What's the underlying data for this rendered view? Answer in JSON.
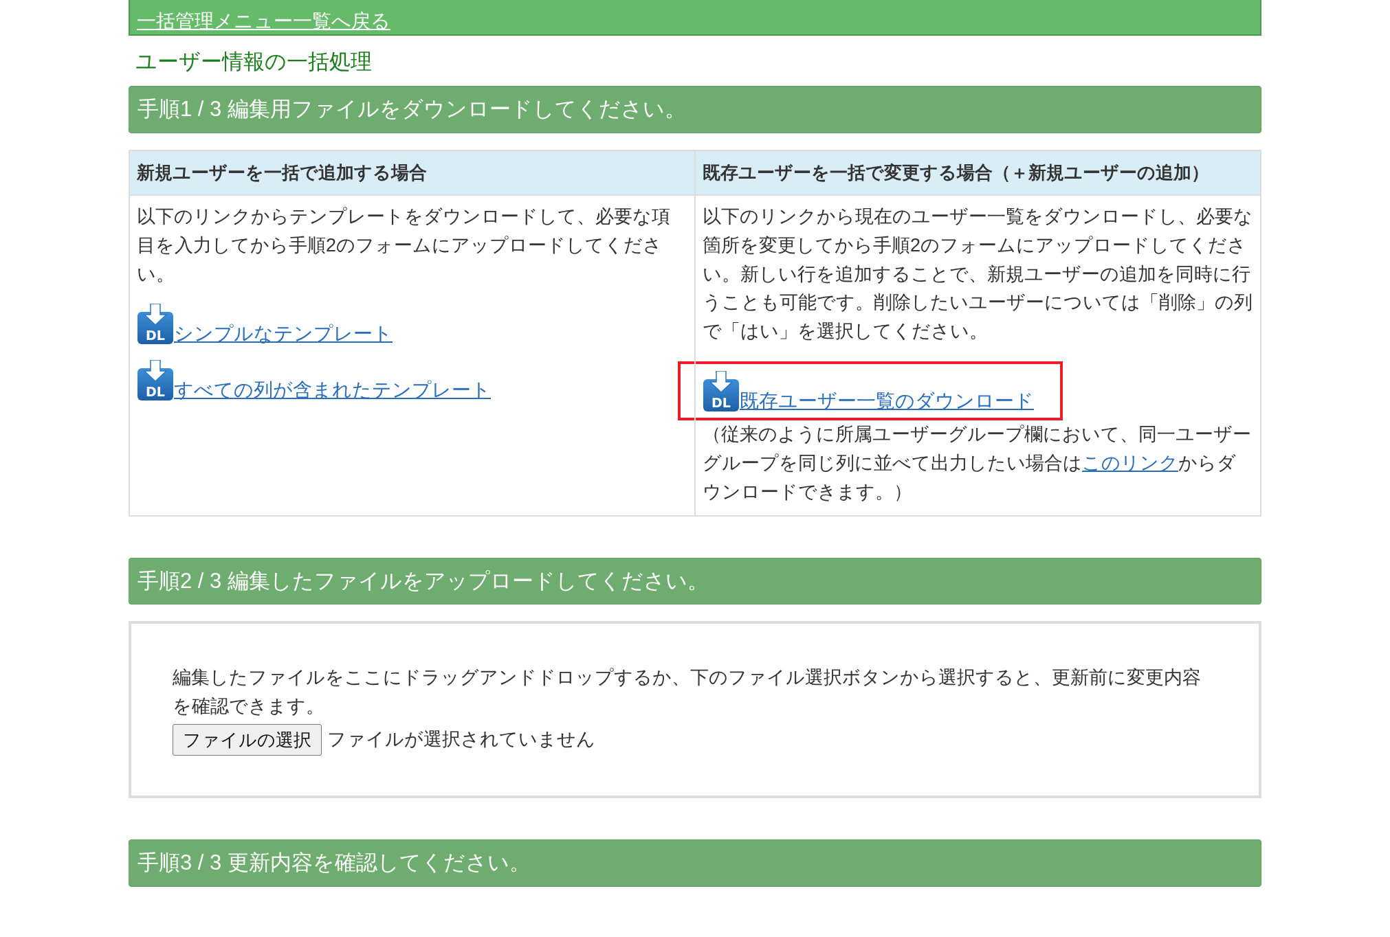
{
  "back_link": "一括管理メニュー一覧へ戻る",
  "page_title": "ユーザー情報の一括処理",
  "steps": [
    {
      "kind": "download",
      "heading": "手順1 / 3 編集用ファイルをダウンロードしてください。",
      "columns": [
        {
          "header": "新規ユーザーを一括で追加する場合",
          "description": "以下のリンクからテンプレートをダウンロードして、必要な項目を入力してから手順2のフォームにアップロードしてください。",
          "links": [
            {
              "icon_text": "DL",
              "label": "シンプルなテンプレート",
              "highlighted": false
            },
            {
              "icon_text": "DL",
              "label": "すべての列が含まれたテンプレート",
              "highlighted": false
            }
          ]
        },
        {
          "header": "既存ユーザーを一括で変更する場合（＋新規ユーザーの追加）",
          "description": "以下のリンクから現在のユーザー一覧をダウンロードし、必要な箇所を変更してから手順2のフォームにアップロードしてください。新しい行を追加することで、新規ユーザーの追加を同時に行うことも可能です。削除したいユーザーについては「削除」の列で「はい」を選択してください。",
          "links": [
            {
              "icon_text": "DL",
              "label": "既存ユーザー一覧のダウンロード",
              "highlighted": true
            }
          ],
          "note": {
            "before": "（従来のように所属ユーザーグループ欄において、同一ユーザーグループを同じ列に並べて出力したい場合は",
            "link": "このリンク",
            "after": "からダウンロードできます。）"
          }
        }
      ]
    },
    {
      "kind": "upload",
      "heading": "手順2 / 3 編集したファイルをアップロードしてください。",
      "dropzone": {
        "description": "編集したファイルをここにドラッグアンドドロップするか、下のファイル選択ボタンから選択すると、更新前に変更内容を確認できます。",
        "button": "ファイルの選択",
        "status": "ファイルが選択されていません"
      }
    },
    {
      "kind": "confirm",
      "heading": "手順3 / 3 更新内容を確認してください。"
    }
  ]
}
